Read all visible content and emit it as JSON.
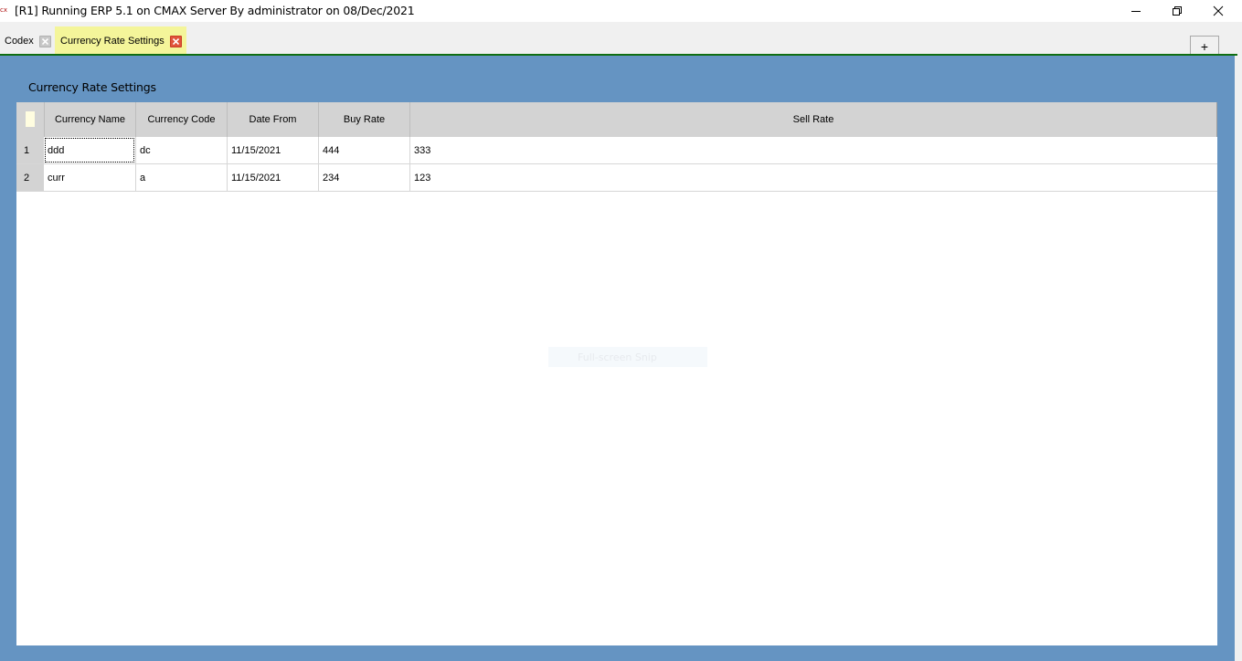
{
  "window": {
    "app_icon": "erp-app-icon",
    "title": "[R1] Running ERP 5.1 on CMAX Server By administrator on 08/Dec/2021",
    "controls": {
      "minimize": "minimize-icon",
      "restore": "restore-icon",
      "close": "close-icon"
    }
  },
  "tabs": [
    {
      "label": "Codex",
      "active": false,
      "close_icon": "close-tab-icon"
    },
    {
      "label": "Currency Rate Settings",
      "active": true,
      "close_icon": "close-tab-icon"
    }
  ],
  "add_tab_label": "+",
  "colors": {
    "active_tab": "#f4f59a",
    "tab_underline": "#0f6e12",
    "content_background": "#6594c2",
    "grid_header": "#d3d3d3",
    "active_tab_close": "#e0533b"
  },
  "form": {
    "title": "Currency Rate Settings"
  },
  "grid": {
    "columns": [
      "Currency Name",
      "Currency Code",
      "Date From",
      "Buy Rate",
      "Sell Rate"
    ],
    "rows": [
      {
        "num": "1",
        "cells": [
          "ddd",
          "dc",
          "11/15/2021",
          "444",
          "333"
        ]
      },
      {
        "num": "2",
        "cells": [
          "curr",
          "a",
          "11/15/2021",
          "234",
          "123"
        ]
      }
    ]
  },
  "overlay": {
    "label": "Full-screen Snip"
  }
}
